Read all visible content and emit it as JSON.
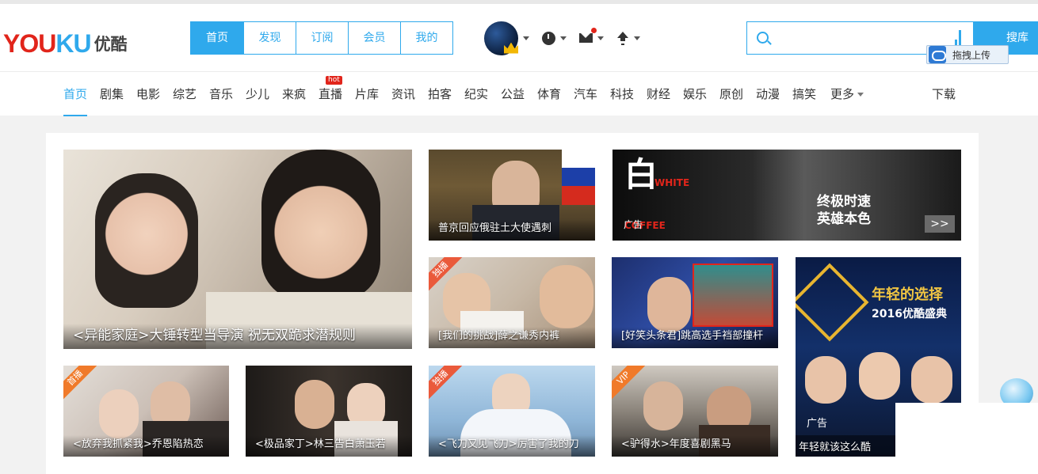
{
  "header": {
    "logo_text_red": "YOU",
    "logo_text_blue": "KU",
    "logo_cn": "优酷",
    "nav": [
      {
        "label": "首页",
        "active": true
      },
      {
        "label": "发现",
        "active": false
      },
      {
        "label": "订阅",
        "active": false
      },
      {
        "label": "会员",
        "active": false
      },
      {
        "label": "我的",
        "active": false
      }
    ],
    "tools": [
      "history-icon",
      "message-icon",
      "upload-icon"
    ],
    "search": {
      "placeholder": "",
      "button": "搜库"
    },
    "drag_upload": "拖拽上传"
  },
  "channels": {
    "items": [
      "首页",
      "剧集",
      "电影",
      "综艺",
      "音乐",
      "少儿",
      "来疯",
      "直播",
      "片库",
      "资讯",
      "拍客",
      "纪实",
      "公益",
      "体育",
      "汽车",
      "科技",
      "财经",
      "娱乐",
      "原创",
      "动漫",
      "搞笑",
      "更多"
    ],
    "active": "首页",
    "hot_badge": "hot",
    "download": "下载"
  },
  "cards": {
    "c0": {
      "caption": "<异能家庭>大锤转型当导演 祝无双跪求潜规则"
    },
    "c1": {
      "caption": "普京回应俄驻土大使遇刺"
    },
    "c2": {
      "caption": "",
      "ad_label": "广告",
      "slogan_1": "终极时速",
      "slogan_2": "英雄本色",
      "next": ">>"
    },
    "c3": {
      "caption": "[我们的挑战]薛之谦秀内裤",
      "tag": "独播"
    },
    "c4": {
      "caption": "[好笑头条君]跳高选手裆部撞杆"
    },
    "c5": {
      "caption": "年轻就该这么酷",
      "ad_label": "广告",
      "title_1": "年轻的选择",
      "title_2": "2016优酷盛典"
    },
    "c6": {
      "caption": "<放弃我抓紧我>乔恩陷热恋",
      "tag": "首播"
    },
    "c7": {
      "caption": "<极品家丁>林三告白萧玉若"
    },
    "c8": {
      "caption": "<飞刀又见飞刀>厉害了我的刀",
      "tag": "独播"
    },
    "c9": {
      "caption": "<驴得水>年度喜剧黑马",
      "tag": "VIP"
    }
  },
  "colors": {
    "accent": "#2fa9ec",
    "brand_red": "#e1251b"
  }
}
